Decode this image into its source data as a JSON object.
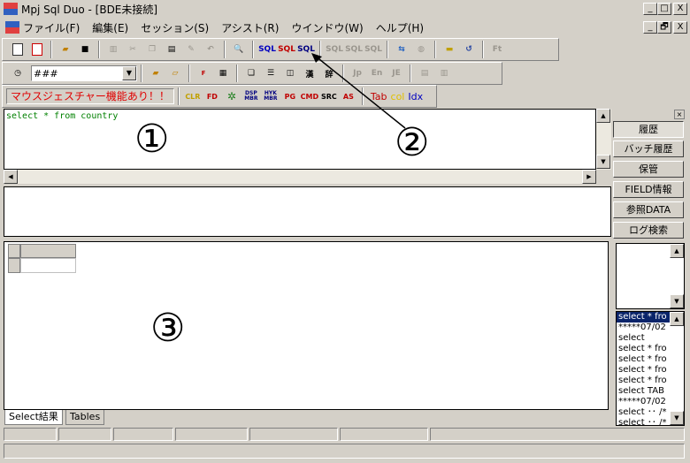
{
  "window": {
    "title": "Mpj Sql Duo - [BDE未接続]",
    "minimize": "_",
    "maximize": "□",
    "close": "X"
  },
  "child_window": {
    "minimize": "_",
    "restore": "🗗",
    "close": "X"
  },
  "menu": [
    "ファイル(F)",
    "編集(E)",
    "セッション(S)",
    "アシスト(R)",
    "ウインドウ(W)",
    "ヘルプ(H)"
  ],
  "toolbar": {
    "combo_value": "###",
    "gesture_label": "マウスジェスチャー機能あり！！",
    "sql_label": "SQL",
    "ft_label": "Ft",
    "jp_label": "Jp",
    "en_label": "En",
    "je_label": "JE",
    "tab_col_idx": [
      "Tab",
      "col",
      "Idx"
    ],
    "mini_icons": [
      "CLR",
      "FD",
      "DSP MBR",
      "HYK MBR",
      "PG",
      "CMD",
      "SRC",
      "AS"
    ]
  },
  "editor": {
    "code": "select * from country"
  },
  "annotations": {
    "one": "①",
    "two": "②",
    "three": "③"
  },
  "right_panel": {
    "buttons": [
      "履歴",
      "バッチ履歴",
      "保管",
      "FIELD情報",
      "参照DATA",
      "ログ検索"
    ],
    "history": [
      "select * fro",
      "*****07/02",
      "select",
      "select * fro",
      "select * fro",
      "select * fro",
      "select * fro",
      "select TAB",
      "*****07/02",
      "select ･･ /*",
      "select ･･ /*"
    ]
  },
  "tabs": [
    "Select結果",
    "Tables"
  ]
}
